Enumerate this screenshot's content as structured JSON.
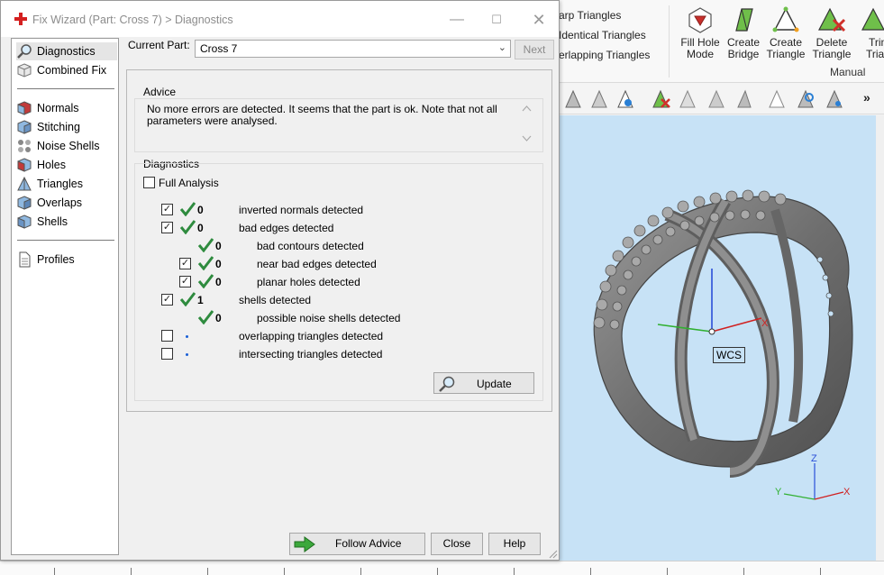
{
  "ribbon": {
    "list_items": [
      "arp Triangles",
      "Identical Triangles",
      "erlapping Triangles"
    ],
    "buttons": [
      {
        "line1": "Fill Hole",
        "line2": "Mode",
        "icon": "fill-hole-icon"
      },
      {
        "line1": "Create",
        "line2": "Bridge",
        "icon": "create-bridge-icon"
      },
      {
        "line1": "Create",
        "line2": "Triangle",
        "icon": "create-triangle-icon"
      },
      {
        "line1": "Delete",
        "line2": "Triangle",
        "icon": "delete-triangle-icon"
      },
      {
        "line1": "Trim",
        "line2": "Triang",
        "icon": "trim-triangle-icon"
      }
    ],
    "group_label": "Manual"
  },
  "toolbar": {
    "more": "»"
  },
  "viewport": {
    "wcs_label": "WCS",
    "axis_x": "X",
    "axis_y": "Y",
    "axis_z": "Z"
  },
  "dialog": {
    "title": "Fix Wizard (Part: Cross 7) > Diagnostics",
    "current_part_label": "Current Part:",
    "current_part_value": "Cross 7",
    "next_label": "Next",
    "nav": {
      "top": [
        {
          "label": "Diagnostics",
          "icon": "magnifier-icon",
          "selected": true
        },
        {
          "label": "Combined Fix",
          "icon": "cube-icon"
        }
      ],
      "middle": [
        {
          "label": "Normals",
          "icon": "normals-cube-icon"
        },
        {
          "label": "Stitching",
          "icon": "stitching-cube-icon"
        },
        {
          "label": "Noise Shells",
          "icon": "noise-shells-icon"
        },
        {
          "label": "Holes",
          "icon": "holes-cube-icon"
        },
        {
          "label": "Triangles",
          "icon": "triangles-icon"
        },
        {
          "label": "Overlaps",
          "icon": "overlaps-icon"
        },
        {
          "label": "Shells",
          "icon": "shells-icon"
        }
      ],
      "bottom": [
        {
          "label": "Profiles",
          "icon": "document-icon"
        }
      ]
    },
    "advice": {
      "title": "Advice",
      "line1": "No more errors are detected. It seems that the part is ok. Note that not all",
      "line2": "parameters were analysed."
    },
    "diagnostics": {
      "title": "Diagnostics",
      "full_analysis_label": "Full Analysis",
      "full_analysis_checked": false,
      "rows": [
        {
          "checked": true,
          "status": "ok",
          "count": "0",
          "label": "inverted normals detected",
          "indent": 0
        },
        {
          "checked": true,
          "status": "ok",
          "count": "0",
          "label": "bad edges detected",
          "indent": 0
        },
        {
          "checked": null,
          "status": "ok",
          "count": "0",
          "label": "bad contours detected",
          "indent": 1
        },
        {
          "checked": true,
          "status": "ok",
          "count": "0",
          "label": "near bad edges detected",
          "indent": 1
        },
        {
          "checked": true,
          "status": "ok",
          "count": "0",
          "label": "planar holes detected",
          "indent": 1
        },
        {
          "checked": true,
          "status": "ok",
          "count": "1",
          "label": "shells detected",
          "indent": 0
        },
        {
          "checked": null,
          "status": "ok",
          "count": "0",
          "label": "possible noise shells detected",
          "indent": 1
        },
        {
          "checked": false,
          "status": "not-run",
          "count": "",
          "label": "overlapping triangles detected",
          "indent": 0
        },
        {
          "checked": false,
          "status": "not-run",
          "count": "",
          "label": "intersecting triangles detected",
          "indent": 0
        }
      ],
      "update_label": "Update"
    },
    "buttons": {
      "follow_advice": "Follow Advice",
      "close": "Close",
      "help": "Help"
    }
  },
  "colors": {
    "check_green": "#2e8b3e",
    "viewport_bg": "#c7e2f6",
    "model_gray": "#8a8a8a"
  }
}
